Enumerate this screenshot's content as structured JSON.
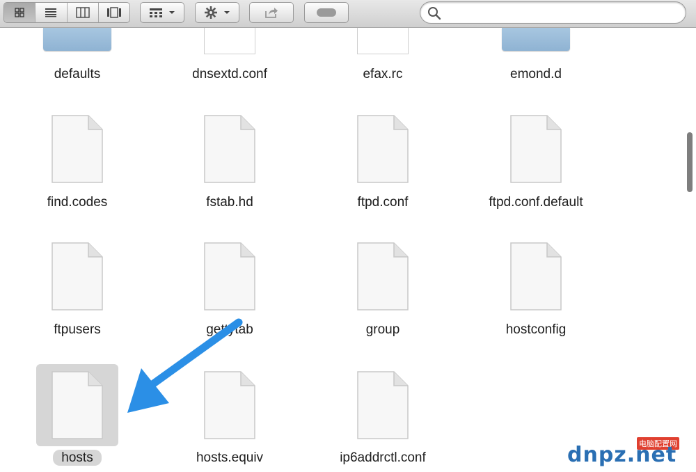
{
  "toolbar": {
    "view_modes": [
      "icon-view",
      "list-view",
      "column-view",
      "coverflow-view"
    ],
    "active_view": "icon-view",
    "arrange_icon": "arrange-icon",
    "action_icon": "gear-icon",
    "share_icon": "share-icon",
    "toggle_icon": "tag-toggle-icon",
    "search": {
      "placeholder": "",
      "value": ""
    }
  },
  "files": {
    "row0": [
      {
        "name": "defaults",
        "kind": "folder"
      },
      {
        "name": "dnsextd.conf",
        "kind": "document"
      },
      {
        "name": "efax.rc",
        "kind": "document"
      },
      {
        "name": "emond.d",
        "kind": "folder"
      }
    ],
    "row1": [
      {
        "name": "find.codes",
        "kind": "document"
      },
      {
        "name": "fstab.hd",
        "kind": "document"
      },
      {
        "name": "ftpd.conf",
        "kind": "document"
      },
      {
        "name": "ftpd.conf.default",
        "kind": "document"
      }
    ],
    "row2": [
      {
        "name": "ftpusers",
        "kind": "document"
      },
      {
        "name": "gettytab",
        "kind": "document"
      },
      {
        "name": "group",
        "kind": "document"
      },
      {
        "name": "hostconfig",
        "kind": "document"
      }
    ],
    "row3": [
      {
        "name": "hosts",
        "kind": "document",
        "selected": true
      },
      {
        "name": "hosts.equiv",
        "kind": "document"
      },
      {
        "name": "ip6addrctl.conf",
        "kind": "document"
      }
    ]
  },
  "annotation": {
    "arrow_color": "#2b8fe6",
    "points_to": "hosts"
  },
  "watermark": {
    "main": "dnpz.net",
    "sub": "电脑配置网"
  },
  "colors": {
    "selection": "#d6d6d6",
    "folder": "#9bbcd9",
    "scroll_thumb": "#7e7e7e"
  }
}
